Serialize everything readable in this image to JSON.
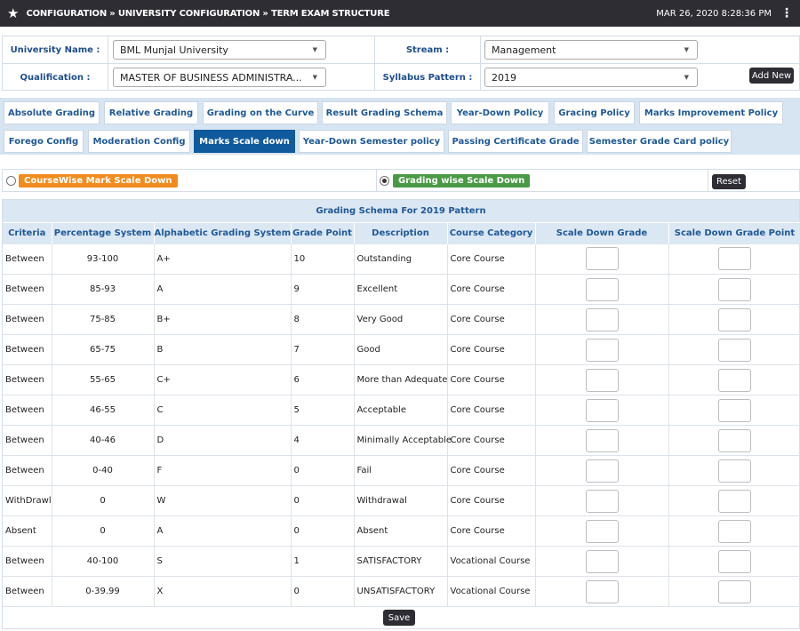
{
  "header": {
    "breadcrumb": "CONFIGURATION » UNIVERSITY CONFIGURATION » TERM EXAM STRUCTURE",
    "datetime": "MAR 26, 2020  8:28:36 PM"
  },
  "filters": {
    "university_label": "University Name :",
    "university_value": "BML Munjal University",
    "stream_label": "Stream :",
    "stream_value": "Management",
    "qualification_label": "Qualification :",
    "qualification_value": "MASTER OF BUSINESS ADMINISTRA...",
    "syllabus_label": "Syllabus Pattern :",
    "syllabus_value": "2019",
    "add_new_label": "Add New"
  },
  "tabs_row1": [
    {
      "label": "Absolute Grading"
    },
    {
      "label": "Relative Grading"
    },
    {
      "label": "Grading on the Curve"
    },
    {
      "label": "Result Grading Schema"
    },
    {
      "label": "Year-Down Policy"
    },
    {
      "label": "Gracing Policy"
    },
    {
      "label": "Marks Improvement Policy"
    }
  ],
  "tabs_row2": [
    {
      "label": "Forego Config"
    },
    {
      "label": "Moderation Config"
    },
    {
      "label": "Marks Scale down"
    },
    {
      "label": "Year-Down Semester policy"
    },
    {
      "label": "Passing Certificate Grade"
    },
    {
      "label": "Semester Grade Card policy"
    }
  ],
  "active_tab": "Marks Scale down",
  "scale_down": {
    "coursewise_label": "CourseWise Mark Scale Down",
    "gradingwise_label": "Grading wise Scale Down",
    "selected": "Grading wise Scale Down",
    "reset_label": "Reset",
    "coursewise_color": "#f28c1e",
    "gradingwise_color": "#4a9a45"
  },
  "grid": {
    "title": "Grading Schema For 2019 Pattern",
    "columns": [
      "Criteria",
      "Percentage System",
      "Alphabetic Grading System",
      "Grade Point",
      "Description",
      "Course Category",
      "Scale Down Grade",
      "Scale Down Grade Point"
    ],
    "rows": [
      [
        "Between",
        "93-100",
        "A+",
        "10",
        "Outstanding",
        "Core Course"
      ],
      [
        "Between",
        "85-93",
        "A",
        "9",
        "Excellent",
        "Core Course"
      ],
      [
        "Between",
        "75-85",
        "B+",
        "8",
        "Very Good",
        "Core Course"
      ],
      [
        "Between",
        "65-75",
        "B",
        "7",
        "Good",
        "Core Course"
      ],
      [
        "Between",
        "55-65",
        "C+",
        "6",
        "More than Adequate",
        "Core Course"
      ],
      [
        "Between",
        "46-55",
        "C",
        "5",
        "Acceptable",
        "Core Course"
      ],
      [
        "Between",
        "40-46",
        "D",
        "4",
        "Minimally Acceptable",
        "Core Course"
      ],
      [
        "Between",
        "0-40",
        "F",
        "0",
        "Fail",
        "Core Course"
      ],
      [
        "WithDrawl",
        "0",
        "W",
        "0",
        "Withdrawal",
        "Core Course"
      ],
      [
        "Absent",
        "0",
        "A",
        "0",
        "Absent",
        "Core Course"
      ],
      [
        "Between",
        "40-100",
        "S",
        "1",
        "SATISFACTORY",
        "Vocational Course"
      ],
      [
        "Between",
        "0-39.99",
        "X",
        "0",
        "UNSATISFACTORY",
        "Vocational Course"
      ]
    ],
    "save_label": "Save"
  },
  "icons": {
    "header": "star-icon",
    "menu": "kebab-menu-icon",
    "select": "dropdown-caret-icon"
  }
}
